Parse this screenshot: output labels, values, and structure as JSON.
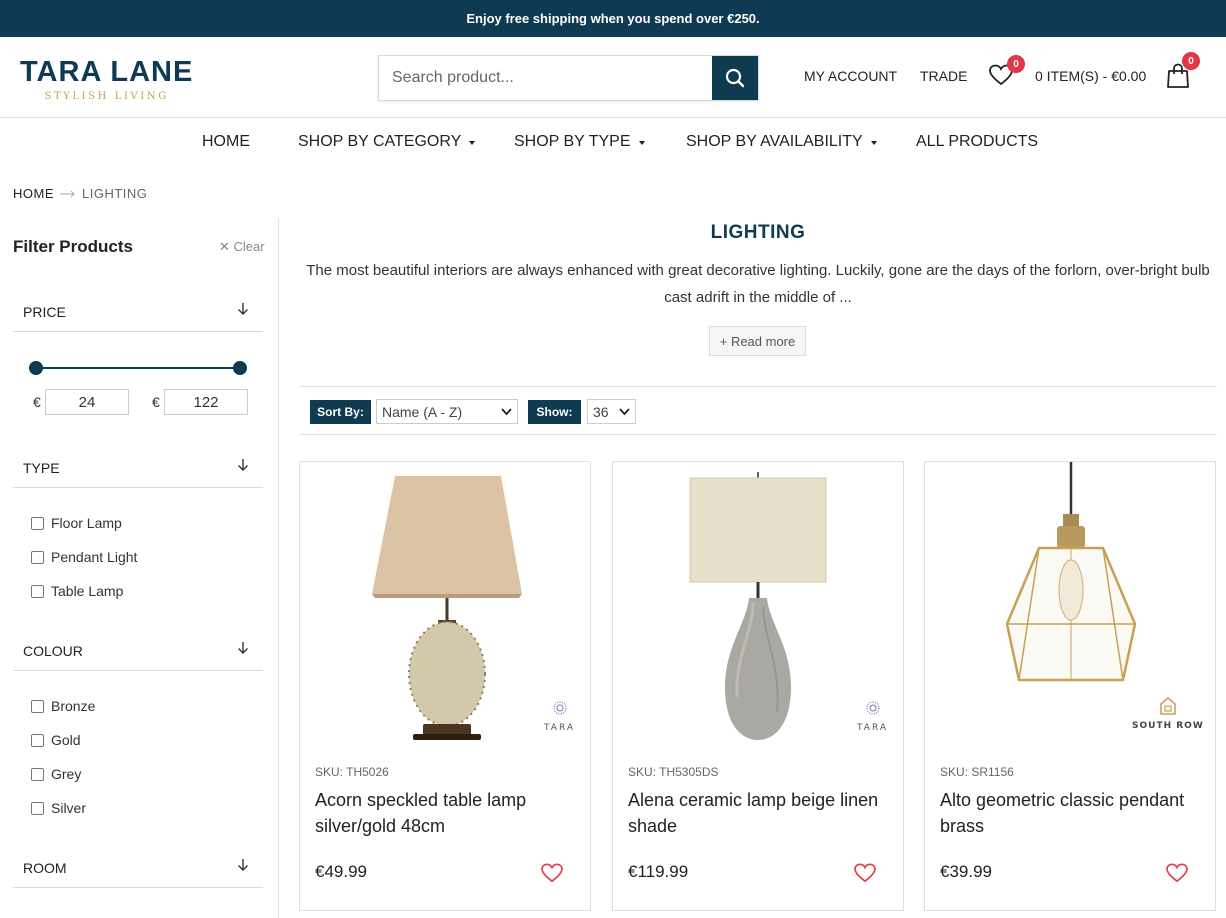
{
  "announcement": "Enjoy free shipping when you spend over €250.",
  "logo": {
    "name": "TARA LANE",
    "tagline": "STYLISH LIVING"
  },
  "search": {
    "placeholder": "Search product..."
  },
  "header": {
    "my_account": "MY ACCOUNT",
    "trade": "TRADE",
    "wishlist_count": "0",
    "cart_label": "0 ITEM(S) - €0.00",
    "cart_count": "0"
  },
  "nav": [
    {
      "label": "HOME"
    },
    {
      "label": "SHOP BY CATEGORY"
    },
    {
      "label": "SHOP BY TYPE"
    },
    {
      "label": "SHOP BY AVAILABILITY"
    },
    {
      "label": "ALL PRODUCTS"
    }
  ],
  "breadcrumb": {
    "home": "HOME",
    "current": "LIGHTING"
  },
  "filters": {
    "title": "Filter Products",
    "clear": "Clear",
    "price": {
      "label": "PRICE",
      "currency": "€",
      "min": "24",
      "max": "122"
    },
    "type": {
      "label": "TYPE",
      "options": [
        "Floor Lamp",
        "Pendant Light",
        "Table Lamp"
      ]
    },
    "colour": {
      "label": "COLOUR",
      "options": [
        "Bronze",
        "Gold",
        "Grey",
        "Silver"
      ]
    },
    "room": {
      "label": "ROOM"
    }
  },
  "category": {
    "title": "LIGHTING",
    "description": "The most beautiful interiors are always enhanced with great decorative lighting. Luckily, gone are the days of the forlorn, over-bright bulb cast adrift in the middle of ...",
    "read_more": "+ Read more"
  },
  "sort": {
    "label": "Sort By:",
    "value": "Name (A - Z)",
    "show_label": "Show:",
    "show_value": "36"
  },
  "products": [
    {
      "sku": "SKU: TH5026",
      "name": "Acorn speckled table lamp silver/gold 48cm",
      "price": "€49.99",
      "brand": "TARA"
    },
    {
      "sku": "SKU: TH5305DS",
      "name": "Alena ceramic lamp beige linen shade",
      "price": "€119.99",
      "brand": "TARA"
    },
    {
      "sku": "SKU: SR1156",
      "name": "Alto geometric classic pendant brass",
      "price": "€39.99",
      "brand": "SOUTH ROW"
    }
  ],
  "colors": {
    "primary": "#0e3a52",
    "accent": "#c9a24d",
    "badge": "#e23744",
    "heart": "#e2414b"
  }
}
